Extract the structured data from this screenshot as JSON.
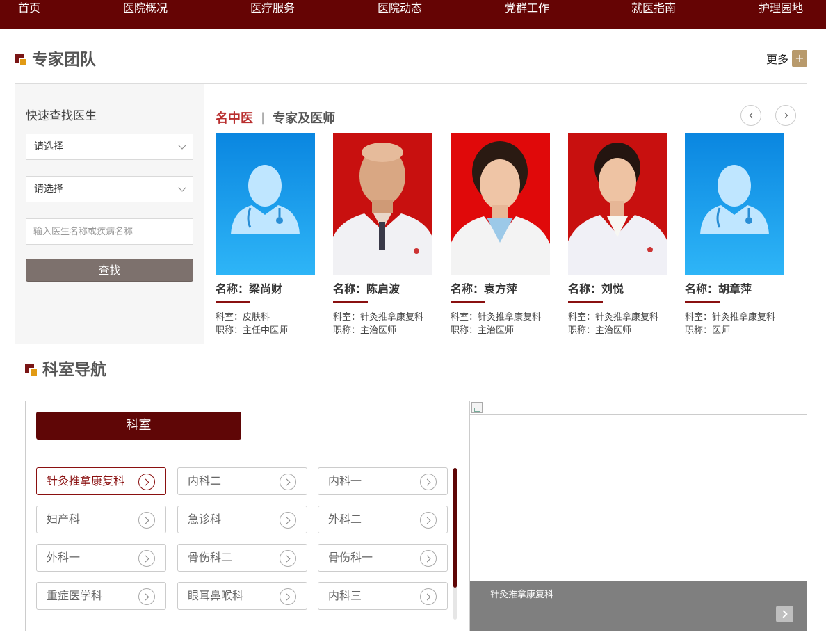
{
  "nav": {
    "items": [
      "首页",
      "医院概况",
      "医疗服务",
      "医院动态",
      "党群工作",
      "就医指南",
      "护理园地"
    ]
  },
  "experts": {
    "title": "专家团队",
    "more_label": "更多",
    "more_icon": "+",
    "finder": {
      "title": "快速查找医生",
      "select1": "请选择",
      "select2": "请选择",
      "search_placeholder": "输入医生名称或疾病名称",
      "search_button": "查找"
    },
    "tabs": {
      "active": "名中医",
      "separator": "|",
      "inactive": "专家及医师"
    },
    "doctors": [
      {
        "name": "名称：梁尚财",
        "dept": "科室：皮肤科",
        "title": "职称：主任中医师",
        "photo": "placeholder"
      },
      {
        "name": "名称：陈启波",
        "dept": "科室：针灸推拿康复科",
        "title": "职称：主治医师",
        "photo": "male-doctor"
      },
      {
        "name": "名称：袁方萍",
        "dept": "科室：针灸推拿康复科",
        "title": "职称：主治医师",
        "photo": "female-doctor"
      },
      {
        "name": "名称：刘悦",
        "dept": "科室：针灸推拿康复科",
        "title": "职称：主治医师",
        "photo": "female-doctor"
      },
      {
        "name": "名称：胡章萍",
        "dept": "科室：针灸推拿康复科",
        "title": "职称：医师",
        "photo": "placeholder"
      }
    ]
  },
  "departments": {
    "title": "科室导航",
    "header": "科室",
    "items": [
      "针灸推拿康复科",
      "内科二",
      "内科一",
      "妇产科",
      "急诊科",
      "外科二",
      "外科一",
      "骨伤科二",
      "骨伤科一",
      "重症医学科",
      "眼耳鼻喉科",
      "内科三"
    ],
    "active_index": 0,
    "caption": "针灸推拿康复科"
  },
  "colors": {
    "nav_bg": "#650404",
    "accent_red": "#b92f2f",
    "dept_header": "#5f0606",
    "icon_gold": "#e19a14"
  }
}
